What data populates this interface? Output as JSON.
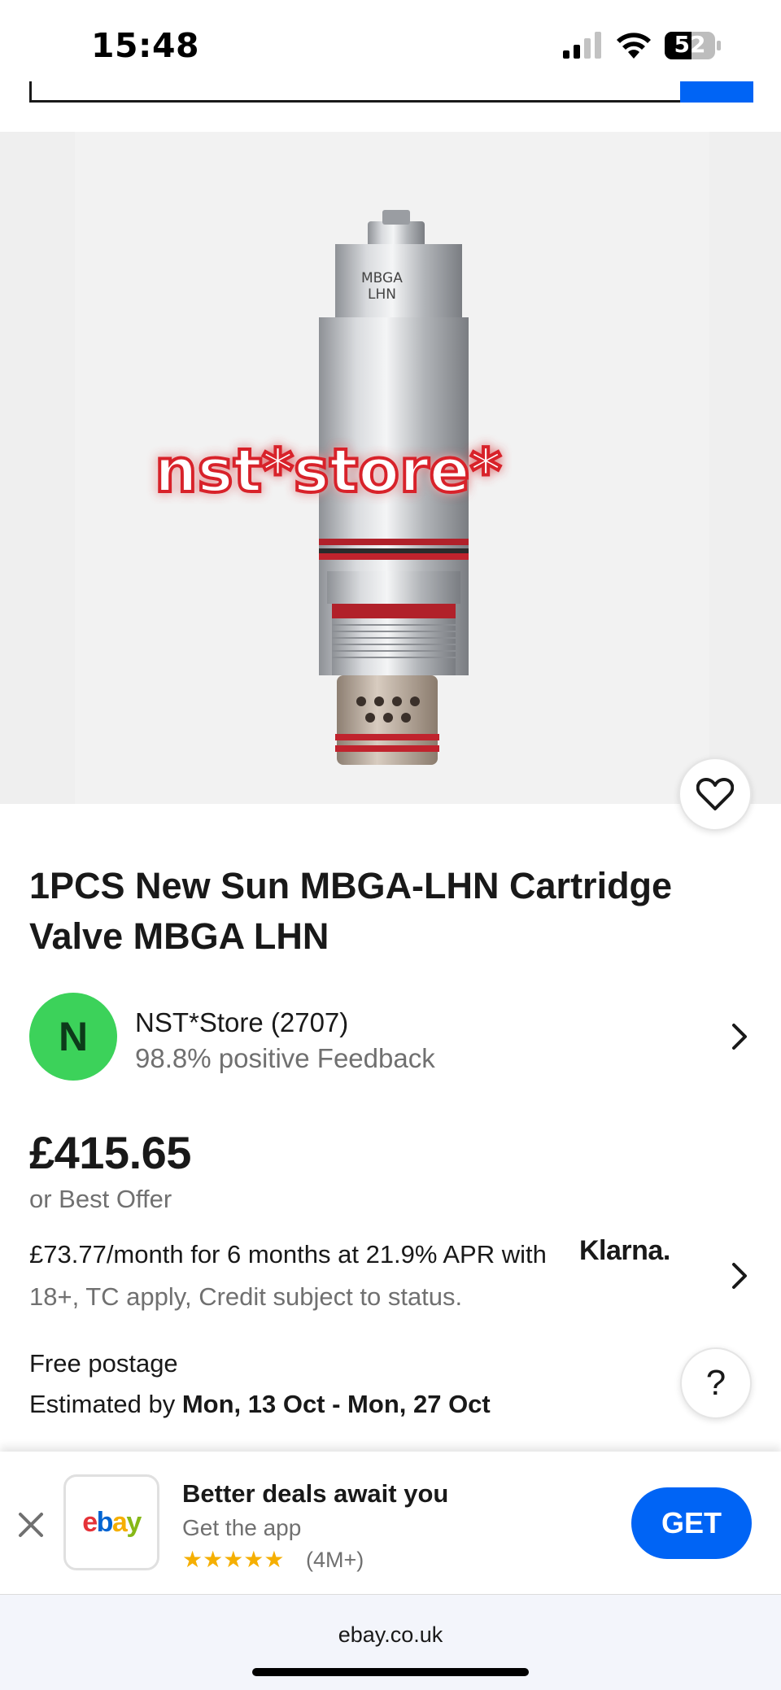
{
  "status_bar": {
    "time": "15:48",
    "battery": "52",
    "icons": [
      "signal-icon",
      "wifi-icon",
      "battery-icon"
    ]
  },
  "product": {
    "watermark": "nst*store*",
    "part_label_line1": "MBGA",
    "part_label_line2": "LHN",
    "title": "1PCS New Sun MBGA-LHN Cartridge Valve MBGA LHN"
  },
  "seller": {
    "initial": "N",
    "name": "NST*Store (2707)",
    "feedback": "98.8% positive Feedback"
  },
  "price": {
    "amount": "£415.65",
    "best_offer": "or Best Offer"
  },
  "klarna": {
    "text": "£73.77/month for 6 months at 21.9% APR with",
    "logo": "Klarna.",
    "terms": "18+, TC apply, Credit subject to status."
  },
  "postage": {
    "title": "Free postage",
    "estimate_prefix": "Estimated by ",
    "estimate_dates": "Mon, 13 Oct - Mon, 27 Oct"
  },
  "help": {
    "label": "?"
  },
  "app_banner": {
    "title": "Better deals await you",
    "subtitle": "Get the app",
    "stars": "★★★★★",
    "rating_count": "(4M+)",
    "rating": 5,
    "get_label": "GET",
    "logo_letters": [
      "e",
      "b",
      "a",
      "y"
    ]
  },
  "browser": {
    "url": "ebay.co.uk"
  },
  "colors": {
    "accent": "#0064f5",
    "avatar": "#3cd25a",
    "secondary_text": "#707070"
  }
}
